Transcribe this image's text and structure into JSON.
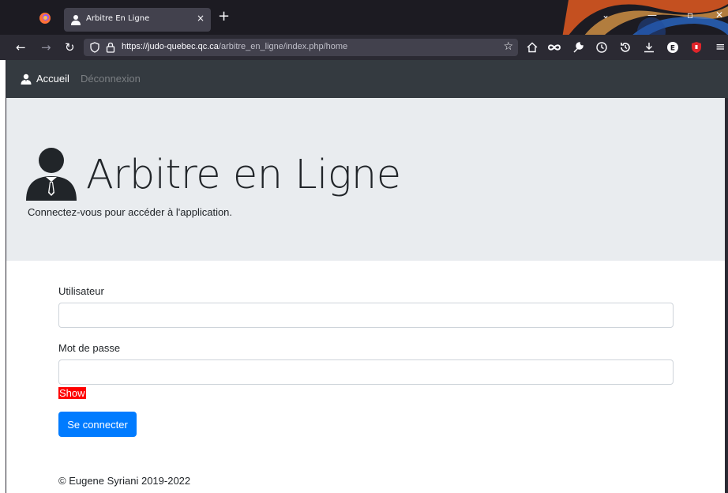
{
  "browser": {
    "tab_title": "Arbitre En Ligne",
    "tab_close": "×",
    "new_tab": "+",
    "url_host": "https://judo-quebec.qc.ca",
    "url_path": "/arbitre_en_ligne/index.php/home",
    "icons": [
      "firefox-icon",
      "back-icon",
      "forward-icon",
      "reload-icon",
      "shield-icon",
      "lock-icon",
      "star-icon",
      "home-icon",
      "infinity-icon",
      "wrench-icon",
      "clock-icon",
      "history-icon",
      "download-icon",
      "extension-icon",
      "ublock-icon",
      "menu-icon"
    ],
    "accent": "#1c1b22"
  },
  "nav": {
    "home": "Accueil",
    "logout": "Déconnexion"
  },
  "hero": {
    "title": "Arbitre en Ligne",
    "lead": "Connectez-vous pour accéder à l'application."
  },
  "form": {
    "user_label": "Utilisateur",
    "user_value": "",
    "password_label": "Mot de passe",
    "password_value": "",
    "show_label": "Show",
    "submit_label": "Se connecter",
    "primary_color": "#007bff"
  },
  "footer": {
    "text": "© Eugene Syriani 2019-2022"
  }
}
